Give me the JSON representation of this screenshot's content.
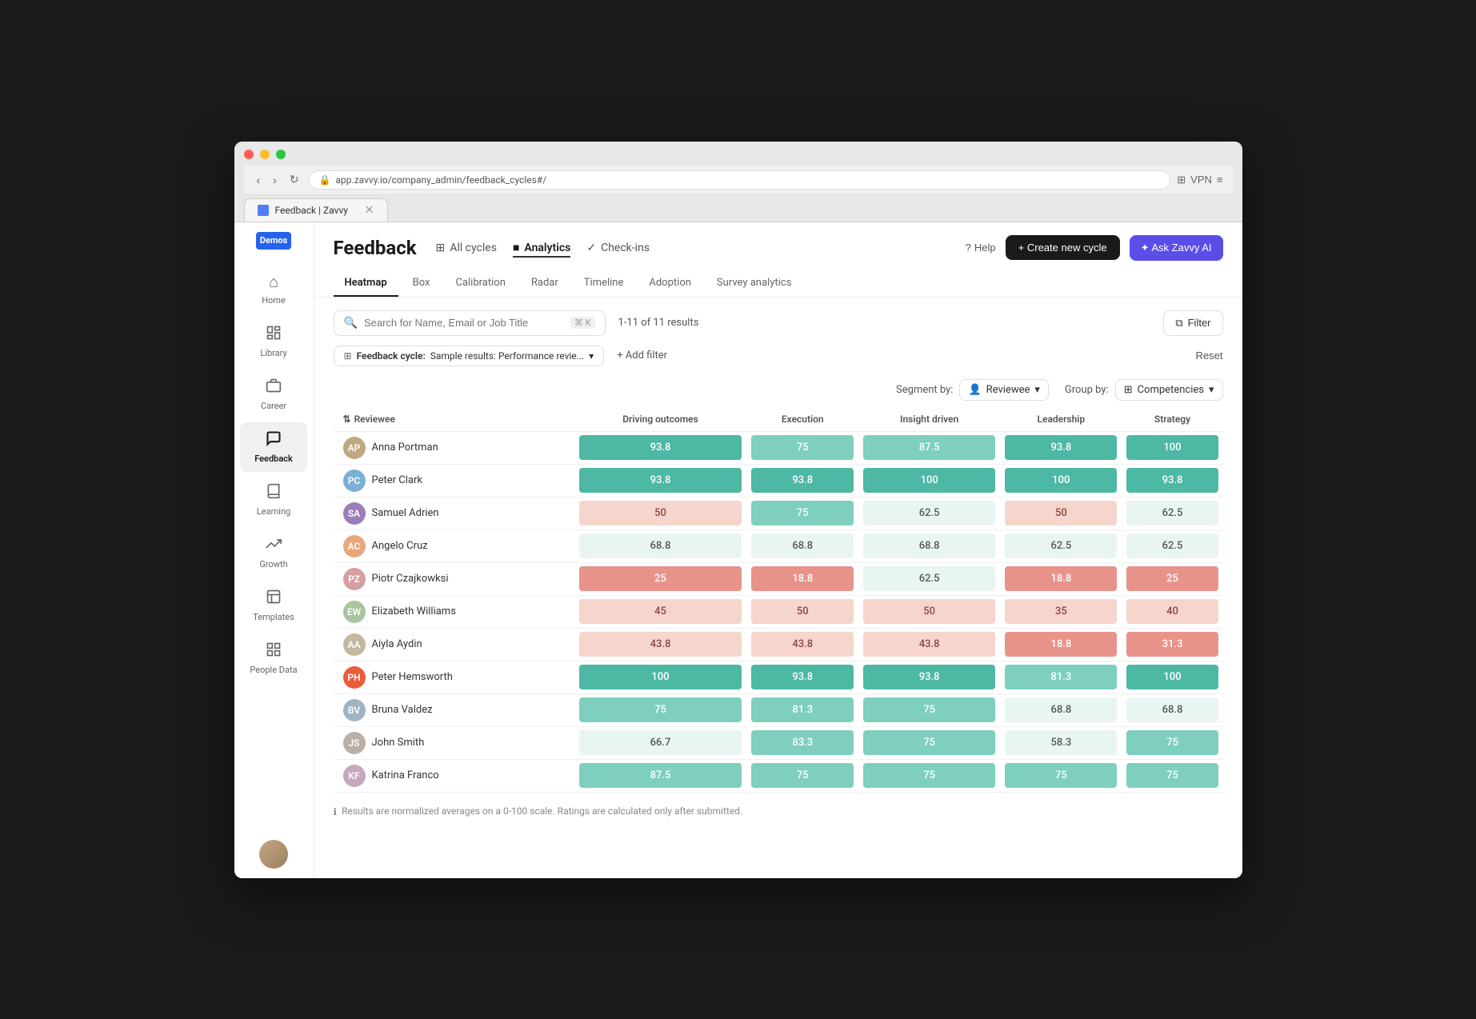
{
  "browser": {
    "tab_title": "Feedback | Zavvy",
    "url": "app.zavvy.io/company_admin/feedback_cycles#/"
  },
  "header": {
    "logo": "Demos",
    "page_title": "Feedback",
    "nav_items": [
      {
        "id": "all-cycles",
        "label": "All cycles",
        "icon": "⊞"
      },
      {
        "id": "analytics",
        "label": "Analytics",
        "icon": "■",
        "active": true
      },
      {
        "id": "check-ins",
        "label": "Check-ins",
        "icon": "✓"
      }
    ],
    "help_label": "Help",
    "create_btn_label": "+ Create new cycle",
    "ai_btn_label": "✦ Ask Zavvy AI"
  },
  "sub_tabs": [
    "Heatmap",
    "Box",
    "Calibration",
    "Radar",
    "Timeline",
    "Adoption",
    "Survey analytics"
  ],
  "active_sub_tab": "Heatmap",
  "toolbar": {
    "search_placeholder": "Search for Name, Email or Job Title",
    "search_shortcut": "⌘ K",
    "result_count": "1-11 of 11 results",
    "filter_label": "Filter",
    "filter_chip_label": "Feedback cycle:",
    "filter_chip_value": "Sample results: Performance revie...",
    "add_filter_label": "+ Add filter",
    "reset_label": "Reset"
  },
  "segment": {
    "segment_by_label": "Segment by:",
    "segment_by_value": "Reviewee",
    "group_by_label": "Group by:",
    "group_by_value": "Competencies"
  },
  "table": {
    "col_reviewee": "Reviewee",
    "columns": [
      "Driving outcomes",
      "Execution",
      "Insight driven",
      "Leadership",
      "Strategy"
    ],
    "rows": [
      {
        "name": "Anna Portman",
        "color": "#c0a882",
        "initials": "AP",
        "scores": [
          93.8,
          75,
          87.5,
          93.8,
          100
        ]
      },
      {
        "name": "Peter Clark",
        "color": "#7bafd4",
        "initials": "PC",
        "scores": [
          93.8,
          93.8,
          100,
          100,
          93.8
        ]
      },
      {
        "name": "Samuel Adrien",
        "color": "#9b7eb8",
        "initials": "SA",
        "scores": [
          50,
          75,
          62.5,
          50,
          62.5
        ]
      },
      {
        "name": "Angelo Cruz",
        "color": "#e8a87c",
        "initials": "AC",
        "scores": [
          68.8,
          68.8,
          68.8,
          62.5,
          62.5
        ]
      },
      {
        "name": "Piotr Czajkowksi",
        "color": "#d4a0a0",
        "initials": "PZ",
        "scores": [
          25,
          18.8,
          62.5,
          18.8,
          25
        ]
      },
      {
        "name": "Elizabeth Williams",
        "color": "#a8c4a0",
        "initials": "EW",
        "scores": [
          45,
          50,
          50,
          35,
          40
        ]
      },
      {
        "name": "Aiyla Aydin",
        "color": "#c4b8a0",
        "initials": "AA",
        "scores": [
          43.8,
          43.8,
          43.8,
          18.8,
          31.3
        ]
      },
      {
        "name": "Peter Hemsworth",
        "color": "#e85c3c",
        "initials": "PH",
        "scores": [
          100,
          93.8,
          93.8,
          81.3,
          100
        ]
      },
      {
        "name": "Bruna Valdez",
        "color": "#a0b4c4",
        "initials": "BV",
        "scores": [
          75,
          81.3,
          75,
          68.8,
          68.8
        ]
      },
      {
        "name": "John Smith",
        "color": "#b8b0a8",
        "initials": "JS",
        "scores": [
          66.7,
          83.3,
          75,
          58.3,
          75
        ]
      },
      {
        "name": "Katrina Franco",
        "color": "#c4a8bc",
        "initials": "KF",
        "scores": [
          87.5,
          75,
          75,
          75,
          75
        ]
      }
    ]
  },
  "footer": {
    "note": "Results are normalized averages on a 0-100 scale. Ratings are calculated only after submitted."
  },
  "sidebar": {
    "logo_text": "Demos",
    "items": [
      {
        "id": "home",
        "label": "Home",
        "icon": "⌂"
      },
      {
        "id": "library",
        "label": "Library",
        "icon": "☰"
      },
      {
        "id": "career",
        "label": "Career",
        "icon": "▦"
      },
      {
        "id": "feedback",
        "label": "Feedback",
        "icon": "💬",
        "active": true
      },
      {
        "id": "learning",
        "label": "Learning",
        "icon": "📖"
      },
      {
        "id": "growth",
        "label": "Growth",
        "icon": "↗"
      },
      {
        "id": "templates",
        "label": "Templates",
        "icon": "⬜"
      },
      {
        "id": "people-data",
        "label": "People Data",
        "icon": "⊞"
      }
    ]
  }
}
